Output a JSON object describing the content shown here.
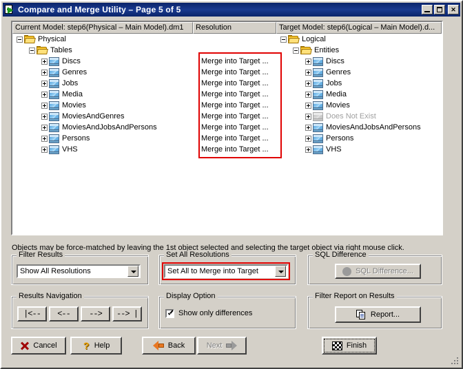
{
  "window": {
    "title": "Compare and Merge Utility  – Page 5 of 5",
    "icon": "compare-merge-icon",
    "buttons": {
      "minimize": "_",
      "maximize": "□",
      "close": "✕"
    }
  },
  "tree": {
    "columns": [
      {
        "id": "current",
        "label": "Current Model: step6(Physical – Main Model).dm1"
      },
      {
        "id": "resolution",
        "label": "Resolution"
      },
      {
        "id": "target",
        "label": "Target Model: step6(Logical – Main Model).d..."
      }
    ],
    "left": {
      "root": "Physical",
      "group": "Tables",
      "items": [
        "Discs",
        "Genres",
        "Jobs",
        "Media",
        "Movies",
        "MoviesAndGenres",
        "MoviesAndJobsAndPersons",
        "Persons",
        "VHS"
      ]
    },
    "middle": {
      "resolutions": [
        "Merge into Target ...",
        "Merge into Target ...",
        "Merge into Target ...",
        "Merge into Target ...",
        "Merge into Target ...",
        "Merge into Target ...",
        "Merge into Target ...",
        "Merge into Target ...",
        "Merge into Target ..."
      ],
      "highlight_color": "#e00000"
    },
    "right": {
      "root": "Logical",
      "group": "Entities",
      "items": [
        {
          "label": "Discs",
          "missing": false
        },
        {
          "label": "Genres",
          "missing": false
        },
        {
          "label": "Jobs",
          "missing": false
        },
        {
          "label": "Media",
          "missing": false
        },
        {
          "label": "Movies",
          "missing": false
        },
        {
          "label": "Does Not Exist",
          "missing": true
        },
        {
          "label": "MoviesAndJobsAndPersons",
          "missing": false
        },
        {
          "label": "Persons",
          "missing": false
        },
        {
          "label": "VHS",
          "missing": false
        }
      ]
    }
  },
  "hint": "Objects may be force-matched by leaving the 1st object selected and selecting the target object via right mouse click.",
  "groups": {
    "filter_results": {
      "title": "Filter Results",
      "combo_value": "Show All Resolutions",
      "arrow_icon": "chevron-down-icon"
    },
    "set_all_resolutions": {
      "title": "Set All Resolutions",
      "combo_value": "Set All to Merge into Target",
      "arrow_icon": "chevron-down-icon",
      "highlight_color": "#e00000"
    },
    "sql_difference": {
      "title": "SQL Difference",
      "button_label": "SQL Difference...",
      "button_icon": "sql-circle-icon",
      "disabled": true
    },
    "results_navigation": {
      "title": "Results Navigation",
      "buttons": [
        {
          "id": "first",
          "label": "|<--"
        },
        {
          "id": "prev",
          "label": "<--"
        },
        {
          "id": "next",
          "label": "-->"
        },
        {
          "id": "last",
          "label": "--> |"
        }
      ]
    },
    "display_option": {
      "title": "Display Option",
      "checkbox_label": "Show only differences",
      "checked": true
    },
    "filter_report": {
      "title": "Filter Report on Results",
      "button_label": "Report...",
      "button_icon": "report-pages-icon"
    }
  },
  "footer": {
    "cancel": {
      "label": "Cancel",
      "icon": "x-icon"
    },
    "help": {
      "label": "Help",
      "icon": "question-icon"
    },
    "back": {
      "label": "Back",
      "icon": "arrow-left-icon"
    },
    "next": {
      "label": "Next",
      "icon": "arrow-right-icon",
      "disabled": true
    },
    "finish": {
      "label": "Finish",
      "icon": "checkered-flag-icon",
      "focused": true
    }
  }
}
